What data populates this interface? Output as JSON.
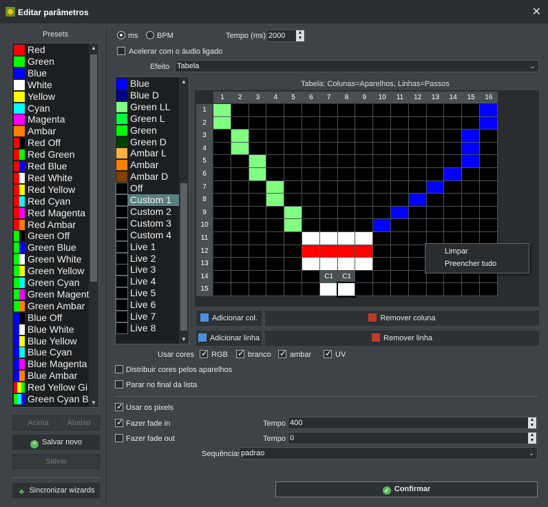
{
  "window": {
    "title": "Editar parâmetros"
  },
  "presets": {
    "label": "Presets",
    "items": [
      {
        "label": "Red",
        "colors": [
          "#ff0000"
        ]
      },
      {
        "label": "Green",
        "colors": [
          "#00ff00"
        ]
      },
      {
        "label": "Blue",
        "colors": [
          "#0000ff"
        ]
      },
      {
        "label": "White",
        "colors": [
          "#ffffff"
        ]
      },
      {
        "label": "Yellow",
        "colors": [
          "#ffff00"
        ]
      },
      {
        "label": "Cyan",
        "colors": [
          "#00ffff"
        ]
      },
      {
        "label": "Magenta",
        "colors": [
          "#ff00ff"
        ]
      },
      {
        "label": "Ambar",
        "colors": [
          "#ff8000"
        ]
      },
      {
        "label": "Red Off",
        "colors": [
          "#ff0000",
          "#000000"
        ]
      },
      {
        "label": "Red Green",
        "colors": [
          "#ff0000",
          "#00ff00"
        ]
      },
      {
        "label": "Red Blue",
        "colors": [
          "#ff0000",
          "#0000ff"
        ]
      },
      {
        "label": "Red White",
        "colors": [
          "#ff0000",
          "#ffffff"
        ]
      },
      {
        "label": "Red Yellow",
        "colors": [
          "#ff0000",
          "#ffff00"
        ]
      },
      {
        "label": "Red Cyan",
        "colors": [
          "#ff0000",
          "#00ffff"
        ]
      },
      {
        "label": "Red Magenta",
        "colors": [
          "#ff0000",
          "#ff00ff"
        ]
      },
      {
        "label": "Red Ambar",
        "colors": [
          "#ff0000",
          "#ff8000"
        ]
      },
      {
        "label": "Green Off",
        "colors": [
          "#00ff00",
          "#000000"
        ]
      },
      {
        "label": "Green Blue",
        "colors": [
          "#00ff00",
          "#0000ff"
        ]
      },
      {
        "label": "Green White",
        "colors": [
          "#00ff00",
          "#ffffff"
        ]
      },
      {
        "label": "Green Yellow",
        "colors": [
          "#00ff00",
          "#ffff00"
        ]
      },
      {
        "label": "Green Cyan",
        "colors": [
          "#00ff00",
          "#00ffff"
        ]
      },
      {
        "label": "Green Magent",
        "colors": [
          "#00ff00",
          "#ff00ff"
        ]
      },
      {
        "label": "Green Ambar",
        "colors": [
          "#00ff00",
          "#ff8000"
        ]
      },
      {
        "label": "Blue Off",
        "colors": [
          "#0000ff",
          "#000000"
        ]
      },
      {
        "label": "Blue White",
        "colors": [
          "#0000ff",
          "#ffffff"
        ]
      },
      {
        "label": "Blue Yellow",
        "colors": [
          "#0000ff",
          "#ffff00"
        ]
      },
      {
        "label": "Blue Cyan",
        "colors": [
          "#0000ff",
          "#00ffff"
        ]
      },
      {
        "label": "Blue Magenta",
        "colors": [
          "#0000ff",
          "#ff00ff"
        ]
      },
      {
        "label": "Blue Ambar",
        "colors": [
          "#0000ff",
          "#ff8000"
        ]
      },
      {
        "label": "Red Yellow Gi",
        "colors": [
          "#ff0000",
          "#ffff00",
          "#00ff00"
        ]
      },
      {
        "label": "Green Cyan B",
        "colors": [
          "#00ff00",
          "#00ffff",
          "#0000ff"
        ]
      }
    ],
    "up_label": "Acima",
    "down_label": "Abaixo",
    "save_new_label": "Salvar novo",
    "save_label": "Salvar",
    "sync_label": "Sincronizar wizards"
  },
  "timing": {
    "ms_label": "ms",
    "bpm_label": "BPM",
    "unit_selected": "ms",
    "tempo_label": "Tempo (ms)",
    "tempo_value": "2000",
    "accelerate_label": "Acelerar com o áudio ligado",
    "accelerate_checked": false
  },
  "effect": {
    "label": "Efeito",
    "value": "Tabela"
  },
  "effect_list": {
    "items": [
      {
        "label": "Blue",
        "color": "#0000ff"
      },
      {
        "label": "Blue D",
        "color": "#00008b"
      },
      {
        "label": "Green LL",
        "color": "#80ff80"
      },
      {
        "label": "Green L",
        "color": "#00ff40"
      },
      {
        "label": "Green",
        "color": "#00ff00"
      },
      {
        "label": "Green D",
        "color": "#004000"
      },
      {
        "label": "Ambar L",
        "color": "#ffb040"
      },
      {
        "label": "Ambar",
        "color": "#ff8000"
      },
      {
        "label": "Ambar D",
        "color": "#804000"
      },
      {
        "label": "Off",
        "color": "#000000"
      },
      {
        "label": "Custom 1",
        "color": "#000000"
      },
      {
        "label": "Custom 2",
        "color": "#000000"
      },
      {
        "label": "Custom 3",
        "color": "#000000"
      },
      {
        "label": "Custom 4",
        "color": "#000000"
      },
      {
        "label": "Live 1",
        "color": "#000000"
      },
      {
        "label": "Live 2",
        "color": "#000000"
      },
      {
        "label": "Live 3",
        "color": "#000000"
      },
      {
        "label": "Live 4",
        "color": "#000000"
      },
      {
        "label": "Live 5",
        "color": "#000000"
      },
      {
        "label": "Live 6",
        "color": "#000000"
      },
      {
        "label": "Live 7",
        "color": "#000000"
      },
      {
        "label": "Live 8",
        "color": "#000000"
      }
    ],
    "selected_index": 10
  },
  "table": {
    "title": "Tabela: Colunas=Aparelhos, Linhas=Passos",
    "columns": [
      "1",
      "2",
      "3",
      "4",
      "5",
      "6",
      "7",
      "8",
      "9",
      "10",
      "11",
      "12",
      "13",
      "14",
      "15",
      "16"
    ],
    "rows": [
      "1",
      "2",
      "3",
      "4",
      "5",
      "6",
      "7",
      "8",
      "9",
      "10",
      "11",
      "12",
      "13",
      "14",
      "15"
    ],
    "cells": [
      {
        "r": 1,
        "c": 1,
        "color": "#80ff80"
      },
      {
        "r": 1,
        "c": 16,
        "color": "#0000ff"
      },
      {
        "r": 2,
        "c": 1,
        "color": "#80ff80"
      },
      {
        "r": 2,
        "c": 16,
        "color": "#0000ff"
      },
      {
        "r": 3,
        "c": 2,
        "color": "#80ff80"
      },
      {
        "r": 3,
        "c": 15,
        "color": "#0000ff"
      },
      {
        "r": 4,
        "c": 2,
        "color": "#80ff80"
      },
      {
        "r": 4,
        "c": 15,
        "color": "#0000ff"
      },
      {
        "r": 5,
        "c": 3,
        "color": "#80ff80"
      },
      {
        "r": 5,
        "c": 15,
        "color": "#0000ff"
      },
      {
        "r": 6,
        "c": 3,
        "color": "#80ff80"
      },
      {
        "r": 6,
        "c": 14,
        "color": "#0000ff"
      },
      {
        "r": 7,
        "c": 4,
        "color": "#80ff80"
      },
      {
        "r": 7,
        "c": 13,
        "color": "#0000ff"
      },
      {
        "r": 8,
        "c": 4,
        "color": "#80ff80"
      },
      {
        "r": 8,
        "c": 12,
        "color": "#0000ff"
      },
      {
        "r": 9,
        "c": 5,
        "color": "#80ff80"
      },
      {
        "r": 9,
        "c": 11,
        "color": "#0000ff"
      },
      {
        "r": 10,
        "c": 5,
        "color": "#80ff80"
      },
      {
        "r": 10,
        "c": 10,
        "color": "#0000ff"
      },
      {
        "r": 11,
        "c": 6,
        "color": "#ffffff"
      },
      {
        "r": 11,
        "c": 7,
        "color": "#ffffff"
      },
      {
        "r": 11,
        "c": 8,
        "color": "#ffffff"
      },
      {
        "r": 11,
        "c": 9,
        "color": "#ffffff"
      },
      {
        "r": 12,
        "c": 6,
        "color": "#ff0000"
      },
      {
        "r": 12,
        "c": 7,
        "color": "#ff0000"
      },
      {
        "r": 12,
        "c": 8,
        "color": "#ff0000"
      },
      {
        "r": 12,
        "c": 9,
        "color": "#ff0000"
      },
      {
        "r": 13,
        "c": 6,
        "color": "#ffffff"
      },
      {
        "r": 13,
        "c": 7,
        "color": "#ffffff"
      },
      {
        "r": 13,
        "c": 8,
        "color": "#ffffff"
      },
      {
        "r": 13,
        "c": 9,
        "color": "#ffffff"
      },
      {
        "r": 15,
        "c": 7,
        "color": "#ffffff"
      },
      {
        "r": 15,
        "c": 8,
        "color": "#ffffff"
      }
    ],
    "cursor_labels": [
      {
        "text": "C1",
        "col": 7,
        "row": 14
      },
      {
        "text": "C1",
        "col": 8,
        "row": 14
      }
    ]
  },
  "context_menu": {
    "items": [
      "Limpar",
      "Preencher tudo"
    ]
  },
  "actions": {
    "add_col": "Adicionar col.",
    "remove_col": "Remover coluna",
    "add_row": "Adicionar linha",
    "remove_row": "Remover linha"
  },
  "colors_opts": {
    "label": "Usar cores",
    "rgb": "RGB",
    "white": "branco",
    "ambar": "ambar",
    "uv": "UV"
  },
  "options": {
    "distribute": "Distribuir cores pelos aparelhos",
    "stop_end": "Parar no final da lista",
    "use_pixels": "Usar os pixels",
    "fade_in": "Fazer fade in",
    "fade_out": "Fazer fade out",
    "tempo_label": "Tempo",
    "fade_in_value": "400",
    "fade_out_value": "0",
    "sequences_label": "Sequências",
    "sequences_value": "padrao"
  },
  "confirm_label": "Confirmar"
}
